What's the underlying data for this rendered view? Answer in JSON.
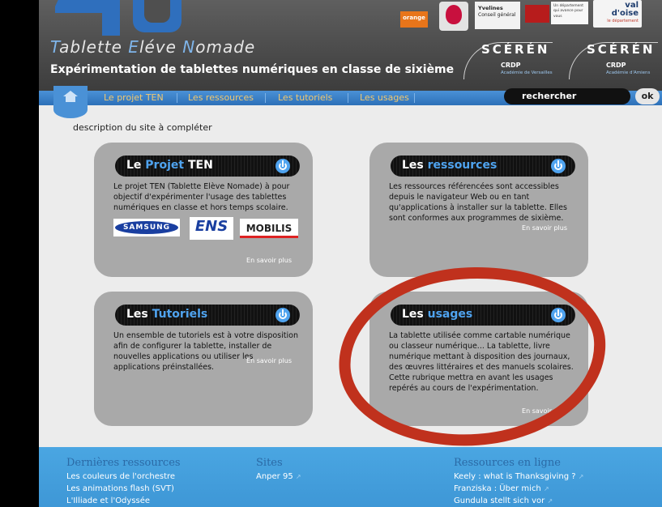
{
  "header": {
    "logo_alt": "TEN logo",
    "site_name": {
      "first_letter_1": "T",
      "part_1": "ablette ",
      "first_letter_2": "E",
      "part_2": "léve ",
      "first_letter_3": "N",
      "part_3": "omade"
    },
    "subtitle": "Expérimentation de tablettes numériques en classe de sixième",
    "partners": {
      "orange": "orange",
      "yvelines_line1": "Yvelines",
      "yvelines_line2": "Conseil général",
      "dept": "Un département qui avance pour vous",
      "valdoise_1": "val",
      "valdoise_2": "d'oise",
      "valdoise_3": "le département"
    },
    "crdp": [
      {
        "brand": "SCÉRÉN",
        "label": "CRDP",
        "sub": "Académie de Versailles"
      },
      {
        "brand": "SCÉRÉN",
        "label": "CRDP",
        "sub": "Académie d'Amiens"
      }
    ]
  },
  "nav": {
    "items": [
      "Le projet TEN",
      "Les ressources",
      "Les tutoriels",
      "Les usages"
    ],
    "search_placeholder": "rechercher",
    "ok_label": "ok"
  },
  "main": {
    "description": "description du site à compléter",
    "cards": [
      {
        "title_plain": "Le ",
        "title_accent": "Projet",
        "title_suffix": " TEN",
        "text": "Le projet TEN (Tablette Elève Nomade) à pour objectif d'expérimenter l'usage des tablettes numériques en classe et hors temps scolaire.",
        "more": "En savoir plus",
        "logos": [
          "SAMSUNG",
          "ENS",
          "MOBILIS"
        ]
      },
      {
        "title_plain": "Les ",
        "title_accent": "ressources",
        "title_suffix": "",
        "text": "Les ressources référencées sont accessibles depuis le navigateur Web ou en tant qu'applications à installer sur la tablette. Elles sont conformes aux programmes de sixième.",
        "more": "En savoir plus"
      },
      {
        "title_plain": "Les ",
        "title_accent": "Tutoriels",
        "title_suffix": "",
        "text": "Un ensemble de tutoriels est à votre disposition afin de configurer la tablette, installer de nouvelles applications ou utiliser les applications préinstallées.",
        "more": "En savoir plus"
      },
      {
        "title_plain": "Les ",
        "title_accent": "usages",
        "title_suffix": "",
        "text": "La tablette utilisée comme cartable numérique ou classeur numérique... La tablette, livre numérique mettant à disposition des journaux, des œuvres littéraires et des manuels scolaires. Cette rubrique mettra en avant les usages repérés au cours de l'expérimentation.",
        "more": "En savoir plus"
      }
    ]
  },
  "footer": {
    "columns": [
      {
        "heading": "Dernières ressources",
        "links": [
          "Les couleurs de l'orchestre",
          "Les animations flash (SVT)",
          "L'Illiade et l'Odyssée"
        ]
      },
      {
        "heading": "Sites",
        "links": [
          "Anper 95"
        ]
      },
      {
        "heading": "Ressources en ligne",
        "links": [
          "Keely : what is Thanksgiving ?",
          "Franziska : Über mich",
          "Gundula stellt sich vor"
        ]
      }
    ]
  },
  "colors": {
    "accent_blue": "#4fa3ef",
    "nav_blue": "#2d70b8",
    "nav_text": "#f1c870",
    "card_gray": "#a9a9a9",
    "annotation_red": "#c0311d",
    "footer_blue": "#4aa6e2"
  }
}
